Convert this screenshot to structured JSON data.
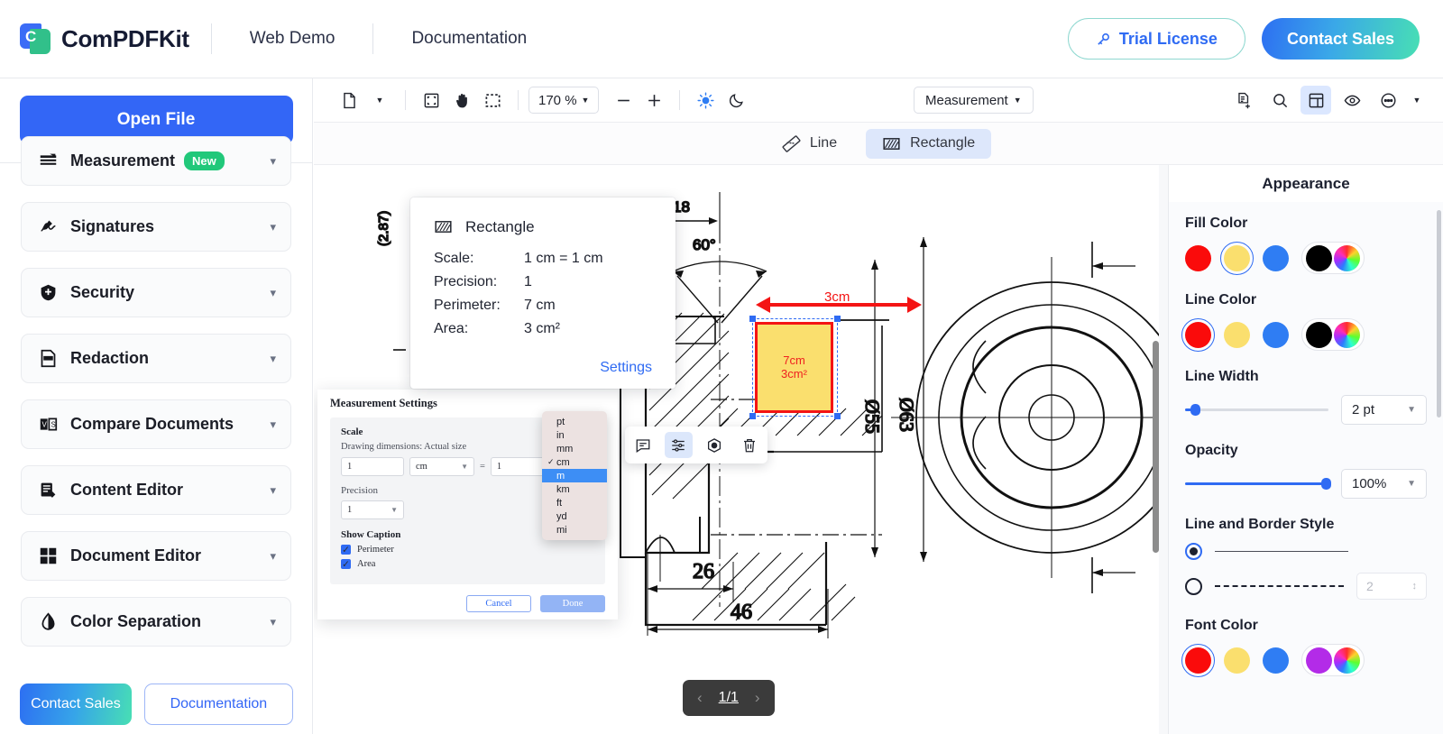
{
  "header": {
    "brand": "ComPDFKit",
    "nav": [
      {
        "label": "Web Demo"
      },
      {
        "label": "Documentation"
      }
    ],
    "trial_label": "Trial License",
    "sales_label": "Contact Sales"
  },
  "sidebar": {
    "open_file_label": "Open File",
    "items": [
      {
        "label": "Measurement",
        "icon": "measurement-icon",
        "badge": "New"
      },
      {
        "label": "Signatures",
        "icon": "signature-icon",
        "badge": ""
      },
      {
        "label": "Security",
        "icon": "shield-icon",
        "badge": ""
      },
      {
        "label": "Redaction",
        "icon": "redaction-icon",
        "badge": ""
      },
      {
        "label": "Compare Documents",
        "icon": "compare-icon",
        "badge": ""
      },
      {
        "label": "Content Editor",
        "icon": "content-editor-icon",
        "badge": ""
      },
      {
        "label": "Document Editor",
        "icon": "document-editor-icon",
        "badge": ""
      },
      {
        "label": "Color Separation",
        "icon": "color-separation-icon",
        "badge": ""
      }
    ],
    "bottom": {
      "sales_label": "Contact Sales",
      "docs_label": "Documentation"
    }
  },
  "toolbar": {
    "zoom_value": "170 %",
    "tool_select": "Measurement",
    "icons": [
      "page-icon",
      "chevron-down-icon",
      "fit-page-icon",
      "hand-icon",
      "marquee-select-icon",
      "minus-icon",
      "plus-icon",
      "sun-icon",
      "moon-icon"
    ],
    "right_icons": [
      "document-properties-icon",
      "search-icon",
      "panel-layout-icon",
      "eye-icon",
      "more-options-icon",
      "chevron-down-icon"
    ]
  },
  "subbar": {
    "modes": [
      {
        "label": "Line",
        "icon": "ruler-icon",
        "selected": false
      },
      {
        "label": "Rectangle",
        "icon": "rectangle-hatch-icon",
        "selected": true
      }
    ]
  },
  "measurement_popup": {
    "title": "Rectangle",
    "rows": [
      {
        "key": "Scale:",
        "value": "1 cm = 1 cm"
      },
      {
        "key": "Precision:",
        "value": "1"
      },
      {
        "key": "Perimeter:",
        "value": "7 cm"
      },
      {
        "key": "Area:",
        "value": "3 cm²"
      }
    ],
    "settings_link": "Settings"
  },
  "measurement_settings": {
    "title": "Measurement Settings",
    "scale_label": "Scale",
    "scale_sub": "Drawing dimensions: Actual size",
    "drawing_value": "1",
    "drawing_unit": "cm",
    "equals": "=",
    "actual_value": "1",
    "precision_label": "Precision",
    "precision_value": "1",
    "show_caption_label": "Show Caption",
    "checkboxes": [
      {
        "label": "Perimeter",
        "checked": true
      },
      {
        "label": "Area",
        "checked": true
      }
    ],
    "cancel_label": "Cancel",
    "done_label": "Done"
  },
  "unit_menu": {
    "options": [
      {
        "label": "pt",
        "checked": false,
        "highlight": false
      },
      {
        "label": "in",
        "checked": false,
        "highlight": false
      },
      {
        "label": "mm",
        "checked": false,
        "highlight": false
      },
      {
        "label": "cm",
        "checked": true,
        "highlight": false
      },
      {
        "label": "m",
        "checked": false,
        "highlight": true
      },
      {
        "label": "km",
        "checked": false,
        "highlight": false
      },
      {
        "label": "ft",
        "checked": false,
        "highlight": false
      },
      {
        "label": "yd",
        "checked": false,
        "highlight": false
      },
      {
        "label": "mi",
        "checked": false,
        "highlight": false
      }
    ]
  },
  "annotation": {
    "caption_line1": "7cm",
    "caption_line2": "3cm²",
    "dimension_label": "3cm",
    "fill_color": "#FADF6E",
    "border_color": "#F41414",
    "toolbar_icons": [
      "note-icon",
      "properties-icon",
      "stamp-icon",
      "delete-icon"
    ]
  },
  "drawing": {
    "labels": [
      {
        "text": "18"
      },
      {
        "text": "60°"
      },
      {
        "text": "26"
      },
      {
        "text": "46"
      },
      {
        "text": "Ø55"
      },
      {
        "text": "Ø63"
      },
      {
        "text": "(2.87)"
      }
    ]
  },
  "page_nav": {
    "prev": "‹",
    "current": "1/1",
    "next": "›"
  },
  "appearance": {
    "title": "Appearance",
    "fill_color": {
      "label": "Fill Color",
      "swatches": [
        "#FA0B0B",
        "#FADF6E",
        "#2F7DF3",
        "#000000"
      ],
      "selected_index": 1,
      "wheel": "color-wheel-icon"
    },
    "line_color": {
      "label": "Line Color",
      "swatches": [
        "#FA0B0B",
        "#FADF6E",
        "#2F7DF3",
        "#000000"
      ],
      "selected_index": 0,
      "wheel": "color-wheel-icon"
    },
    "line_width": {
      "label": "Line Width",
      "value": "2 pt",
      "percent": 8
    },
    "opacity": {
      "label": "Opacity",
      "value": "100%",
      "percent": 100
    },
    "line_border_style": {
      "label": "Line and Border Style",
      "options": [
        {
          "style": "solid",
          "selected": true
        },
        {
          "style": "dashed",
          "selected": false
        }
      ],
      "dash_value": "2"
    },
    "font_color": {
      "label": "Font Color",
      "swatches": [
        "#FA0B0B",
        "#FADF6E",
        "#2F7DF3",
        "#B32BE8"
      ],
      "selected_index": 0,
      "wheel": "color-wheel-icon"
    }
  }
}
